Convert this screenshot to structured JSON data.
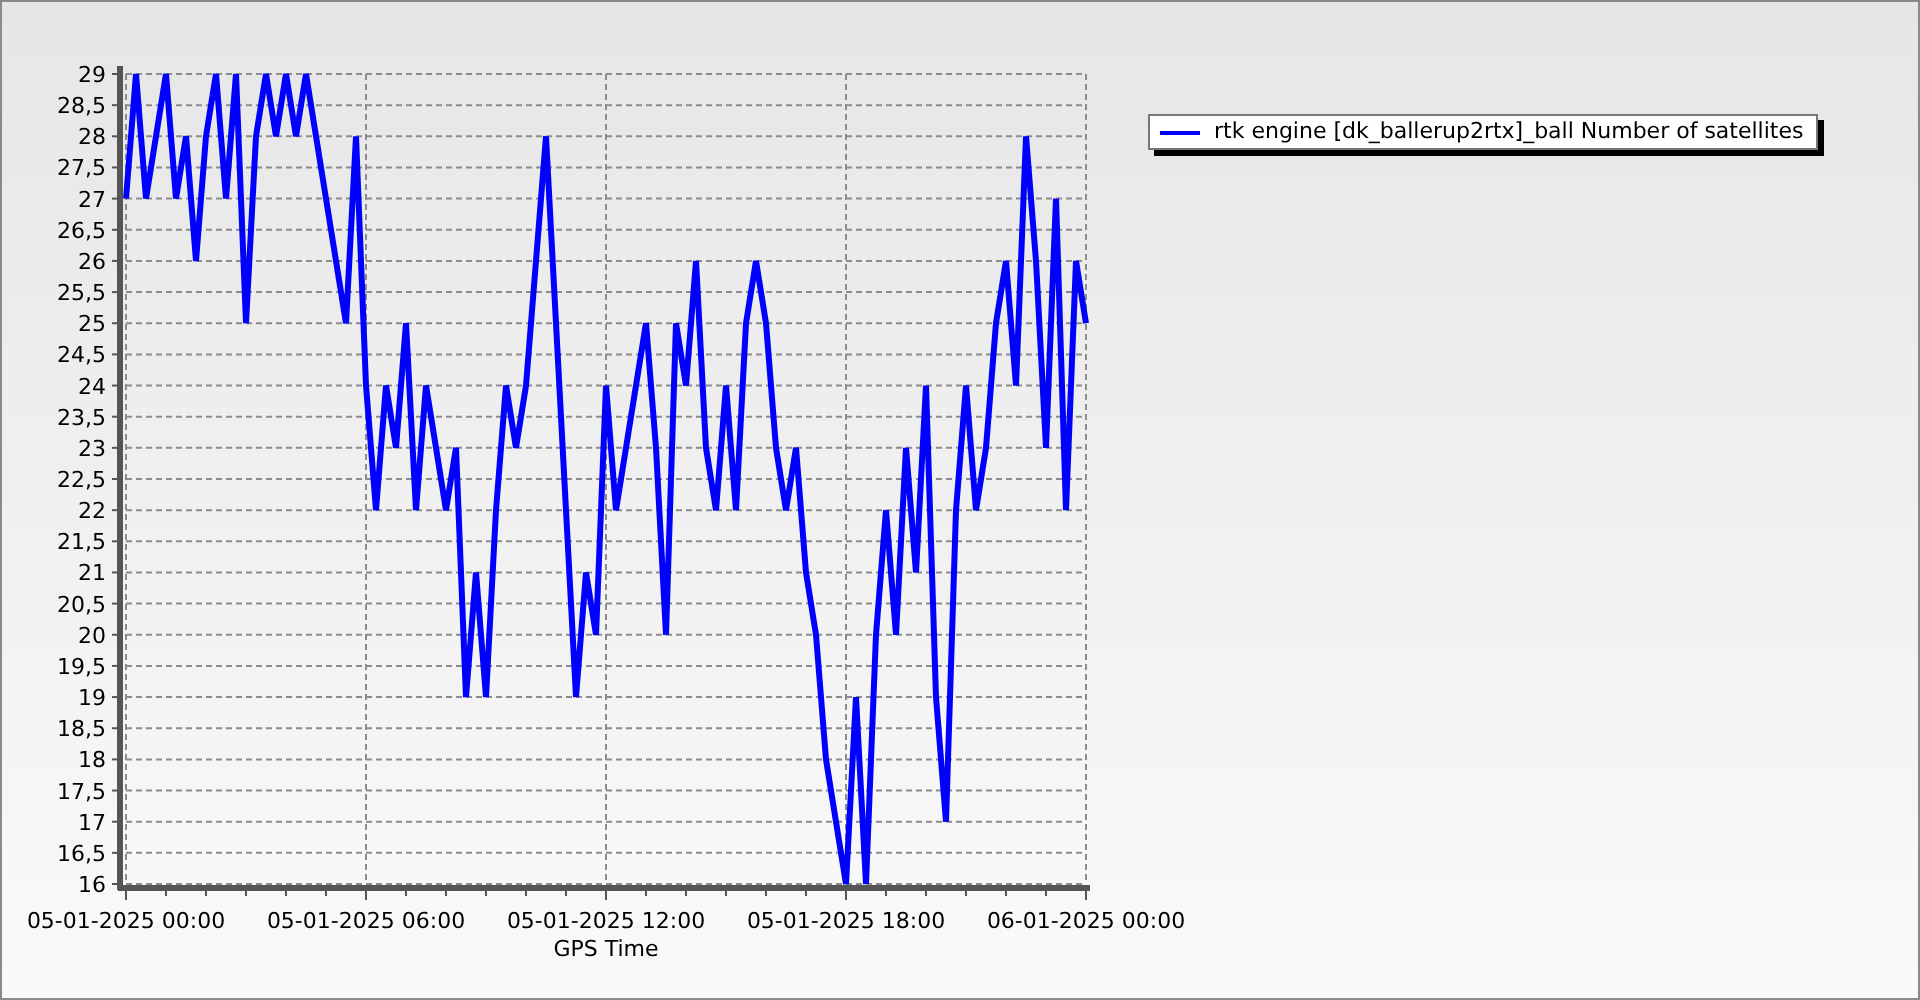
{
  "chart_data": {
    "type": "line",
    "xlabel": "GPS Time",
    "grid": true,
    "ylim": [
      16,
      29
    ],
    "yticks": [
      16,
      {
        "value": 16.5,
        "label": "16,5"
      },
      17,
      {
        "value": 17.5,
        "label": "17,5"
      },
      18,
      {
        "value": 18.5,
        "label": "18,5"
      },
      19,
      {
        "value": 19.5,
        "label": "19,5"
      },
      20,
      {
        "value": 20.5,
        "label": "20,5"
      },
      21,
      {
        "value": 21.5,
        "label": "21,5"
      },
      22,
      {
        "value": 22.5,
        "label": "22,5"
      },
      23,
      {
        "value": 23.5,
        "label": "23,5"
      },
      24,
      {
        "value": 24.5,
        "label": "24,5"
      },
      25,
      {
        "value": 25.5,
        "label": "25,5"
      },
      26,
      {
        "value": 26.5,
        "label": "26,5"
      },
      27,
      {
        "value": 27.5,
        "label": "27,5"
      },
      28,
      {
        "value": 28.5,
        "label": "28,5"
      },
      29
    ],
    "categories": [
      "05-01-2025 00:00",
      null,
      null,
      null,
      null,
      null,
      null,
      null,
      null,
      null,
      null,
      null,
      null,
      null,
      null,
      null,
      null,
      null,
      null,
      null,
      null,
      null,
      null,
      null,
      "05-01-2025 06:00",
      null,
      null,
      null,
      null,
      null,
      null,
      null,
      null,
      null,
      null,
      null,
      null,
      null,
      null,
      null,
      null,
      null,
      null,
      null,
      null,
      null,
      null,
      null,
      "05-01-2025 12:00",
      null,
      null,
      null,
      null,
      null,
      null,
      null,
      null,
      null,
      null,
      null,
      null,
      null,
      null,
      null,
      null,
      null,
      null,
      null,
      null,
      null,
      null,
      null,
      "05-01-2025 18:00",
      null,
      null,
      null,
      null,
      null,
      null,
      null,
      null,
      null,
      null,
      null,
      null,
      null,
      null,
      null,
      null,
      null,
      null,
      null,
      null,
      null,
      null,
      null,
      "06-01-2025 00:00"
    ],
    "series": [
      {
        "name": "rtk engine [dk_ballerup2rtx]_ball Number of satellites",
        "color": "#0000ff",
        "values": [
          27,
          29,
          27,
          28,
          29,
          27,
          28,
          26,
          28,
          29,
          27,
          29,
          25,
          28,
          29,
          28,
          29,
          28,
          29,
          28,
          27,
          26,
          25,
          28,
          24,
          22,
          24,
          23,
          25,
          22,
          24,
          23,
          22,
          23,
          19,
          21,
          19,
          22,
          24,
          23,
          24,
          26,
          28,
          25,
          22,
          19,
          21,
          20,
          24,
          22,
          23,
          24,
          25,
          23,
          20,
          25,
          24,
          26,
          23,
          22,
          24,
          22,
          25,
          26,
          25,
          23,
          22,
          23,
          21,
          20,
          18,
          17,
          16,
          19,
          16,
          20,
          22,
          20,
          23,
          21,
          24,
          19,
          17,
          22,
          24,
          22,
          23,
          25,
          26,
          24,
          28,
          26,
          23,
          27,
          22,
          26,
          25
        ]
      }
    ]
  }
}
